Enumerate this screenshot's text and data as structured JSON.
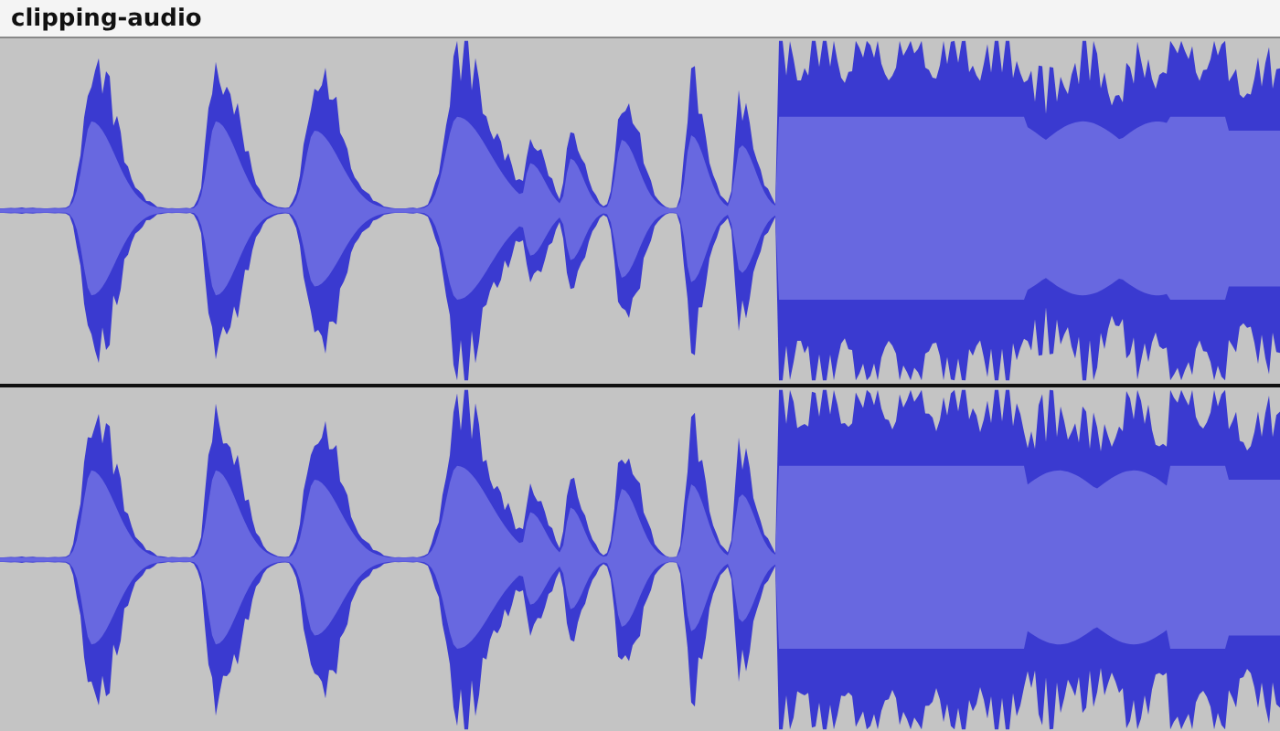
{
  "track": {
    "name": "clipping-audio"
  }
}
